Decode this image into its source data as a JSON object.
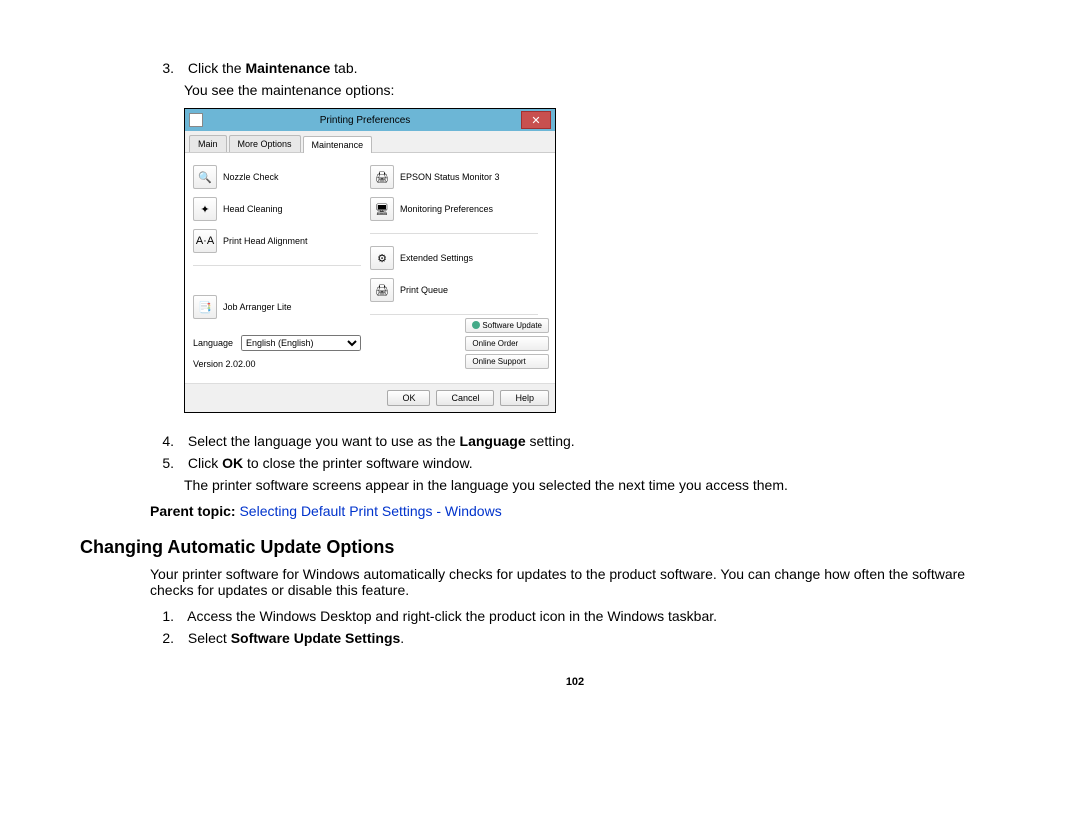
{
  "step3": {
    "num": "3.",
    "prefix": "Click the ",
    "bold": "Maintenance",
    "suffix": " tab."
  },
  "step3_sub": "You see the maintenance options:",
  "dialog": {
    "title": "Printing Preferences",
    "tabs": {
      "main": "Main",
      "more": "More Options",
      "maint": "Maintenance"
    },
    "left": {
      "nozzle": "Nozzle Check",
      "head_clean": "Head Cleaning",
      "align": "Print Head Alignment",
      "arranger": "Job Arranger Lite"
    },
    "right": {
      "status": "EPSON Status Monitor 3",
      "monpref": "Monitoring Preferences",
      "ext": "Extended Settings",
      "queue": "Print Queue"
    },
    "lang_label": "Language",
    "lang_value": "English (English)",
    "version": "Version 2.02.00",
    "rbtns": {
      "update": "Software Update",
      "order": "Online Order",
      "support": "Online Support"
    },
    "footer": {
      "ok": "OK",
      "cancel": "Cancel",
      "help": "Help"
    }
  },
  "step4": {
    "num": "4.",
    "prefix": "Select the language you want to use as the ",
    "bold": "Language",
    "suffix": " setting."
  },
  "step5": {
    "num": "5.",
    "prefix": "Click ",
    "bold": "OK",
    "suffix": " to close the printer software window."
  },
  "step5_sub": "The printer software screens appear in the language you selected the next time you access them.",
  "parent": {
    "label": "Parent topic: ",
    "link": "Selecting Default Print Settings - Windows"
  },
  "section_heading": "Changing Automatic Update Options",
  "section_body": "Your printer software for Windows automatically checks for updates to the product software. You can change how often the software checks for updates or disable this feature.",
  "nstep1": {
    "num": "1.",
    "txt": "Access the Windows Desktop and right-click the product icon in the Windows taskbar."
  },
  "nstep2": {
    "num": "2.",
    "prefix": "Select ",
    "bold": "Software Update Settings",
    "suffix": "."
  },
  "page_num": "102"
}
